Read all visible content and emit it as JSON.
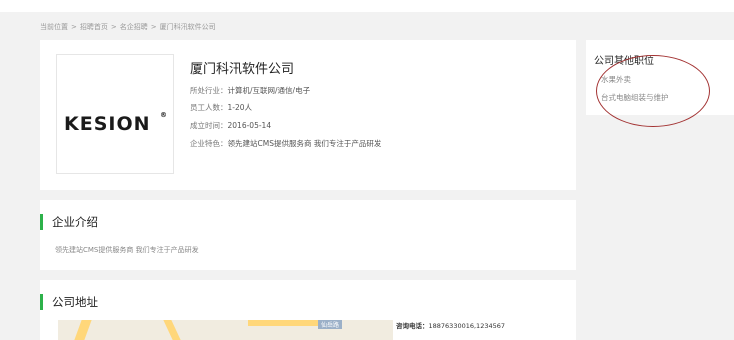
{
  "breadcrumb": {
    "items": [
      "当前位置",
      "招聘首页",
      "名企招聘",
      "厦门科汛软件公司"
    ],
    "separator": ">"
  },
  "company": {
    "logo_text": "KESION",
    "logo_reg": "®",
    "name": "厦门科汛软件公司",
    "industry_label": "所处行业：",
    "industry_value": "计算机/互联网/通信/电子",
    "staff_label": "员工人数：",
    "staff_value": "1-20人",
    "founded_label": "成立时间：",
    "founded_value": "2016-05-14",
    "feature_label": "企业特色：",
    "feature_value": "领先建站CMS提供服务商 我们专注于产品研发"
  },
  "intro": {
    "title": "企业介绍",
    "text": "领先建站CMS提供服务商 我们专注于产品研发"
  },
  "address": {
    "title": "公司地址",
    "map_street": "仙岳路",
    "phone_label": "咨询电话：",
    "phone_value": "18876330016,1234567"
  },
  "sidebar": {
    "title": "公司其他职位",
    "jobs": [
      "水果外卖",
      "台式电脑组装与维护"
    ]
  },
  "colors": {
    "accent": "#2db14a",
    "annotation": "#a33333"
  }
}
